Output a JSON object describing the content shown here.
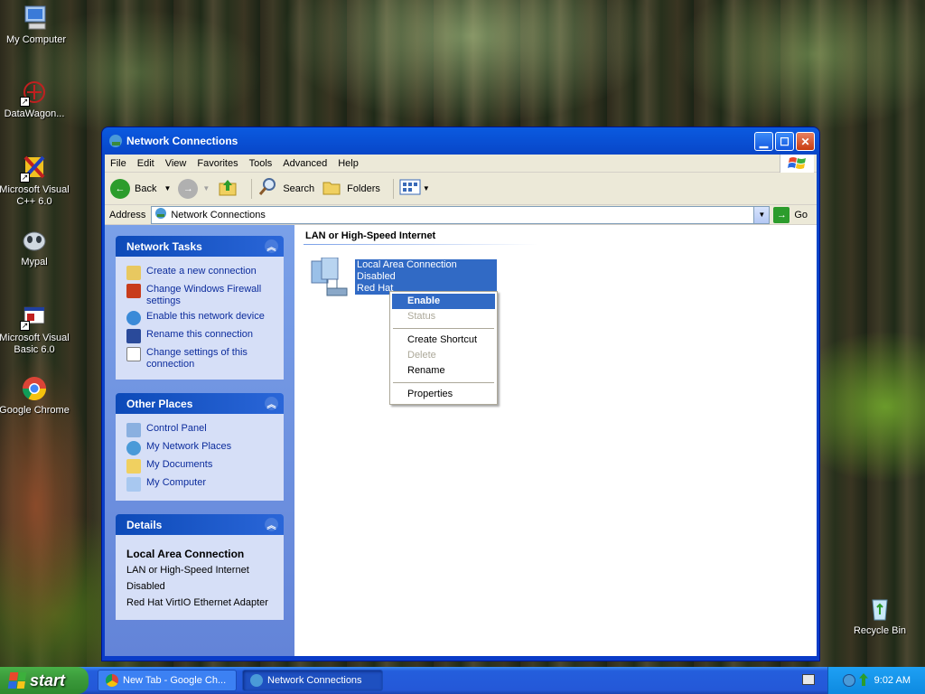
{
  "desktop_icons": [
    {
      "label": "My Computer"
    },
    {
      "label": "DataWagon..."
    },
    {
      "label": "Microsoft Visual C++ 6.0"
    },
    {
      "label": "Mypal"
    },
    {
      "label": "Microsoft Visual Basic 6.0"
    },
    {
      "label": "Google Chrome"
    },
    {
      "label": "Recycle Bin"
    }
  ],
  "window": {
    "title": "Network Connections"
  },
  "menu": [
    "File",
    "Edit",
    "View",
    "Favorites",
    "Tools",
    "Advanced",
    "Help"
  ],
  "toolbar": {
    "back": "Back",
    "search": "Search",
    "folders": "Folders"
  },
  "address": {
    "label": "Address",
    "value": "Network Connections",
    "go": "Go"
  },
  "tasks": {
    "network_tasks": {
      "title": "Network Tasks",
      "items": [
        "Create a new connection",
        "Change Windows Firewall settings",
        "Enable this network device",
        "Rename this connection",
        "Change settings of this connection"
      ]
    },
    "other_places": {
      "title": "Other Places",
      "items": [
        "Control Panel",
        "My Network Places",
        "My Documents",
        "My Computer"
      ]
    },
    "details": {
      "title": "Details",
      "name": "Local Area Connection",
      "type": "LAN or High-Speed Internet",
      "status": "Disabled",
      "adapter": "Red Hat VirtIO Ethernet Adapter"
    }
  },
  "main": {
    "group": "LAN or High-Speed Internet",
    "connection": {
      "name": "Local Area Connection",
      "status": "Disabled",
      "adapter": "Red Hat"
    }
  },
  "context_menu": {
    "enable": "Enable",
    "status": "Status",
    "create_shortcut": "Create Shortcut",
    "delete": "Delete",
    "rename": "Rename",
    "properties": "Properties"
  },
  "taskbar": {
    "start": "start",
    "tasks": [
      "New Tab - Google Ch...",
      "Network Connections"
    ],
    "clock": "9:02 AM"
  }
}
